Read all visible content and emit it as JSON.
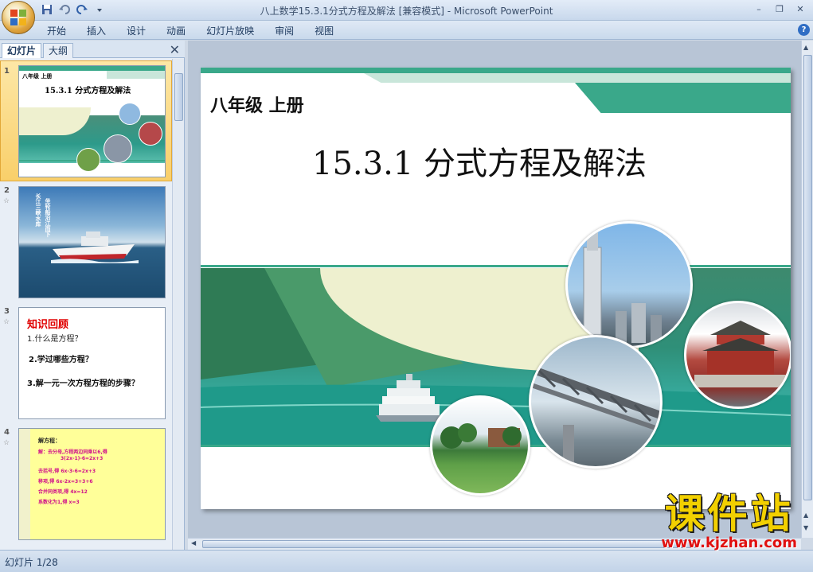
{
  "window": {
    "title": "八上数学15.3.1分式方程及解法 [兼容模式] - Microsoft PowerPoint",
    "minimize": "–",
    "restore": "❐",
    "close": "✕"
  },
  "ribbon": {
    "tabs": [
      "开始",
      "插入",
      "设计",
      "动画",
      "幻灯片放映",
      "审阅",
      "视图"
    ],
    "help": "?"
  },
  "left_pane": {
    "tab_slides": "幻灯片",
    "tab_outline": "大纲",
    "close": "✕",
    "thumbnails": [
      {
        "num": "1",
        "grade": "八年级  上册",
        "title": "15.3.1  分式方程及解法"
      },
      {
        "num": "2",
        "anim": "☆",
        "vertical_text_1": "长江三峡水库",
        "vertical_text_2": "坐轮船沿江而下"
      },
      {
        "num": "3",
        "anim": "☆",
        "heading": "知识回顾",
        "q1": "1.什么是方程？",
        "q2": "2.学过哪些方程？",
        "q3": "3.解一元一次方程方程的步骤？"
      },
      {
        "num": "4",
        "anim": "☆",
        "line1": "解方程：",
        "line2": "解：去分母,方程两边同乘以6,得",
        "line3": "3(2x-1)-6=2x+3",
        "line4": "去括号,得  6x-3-6=2x+3",
        "line5": "移项,得     6x-2x=3+3+6",
        "line6": "合并同类项,得 4x=12",
        "line7": "系数化为1,得    x=3"
      }
    ]
  },
  "slide": {
    "grade": "八年级    上册",
    "title": "15.3.1  分式方程及解法"
  },
  "status": {
    "slide_counter": "幻灯片 1/28"
  },
  "watermark": {
    "brand": "课件站",
    "url": "www.kjzhan.com"
  },
  "colors": {
    "accent_green": "#3aa88a",
    "stripe_light": "#c9e6da",
    "cream": "#eef0cf"
  }
}
